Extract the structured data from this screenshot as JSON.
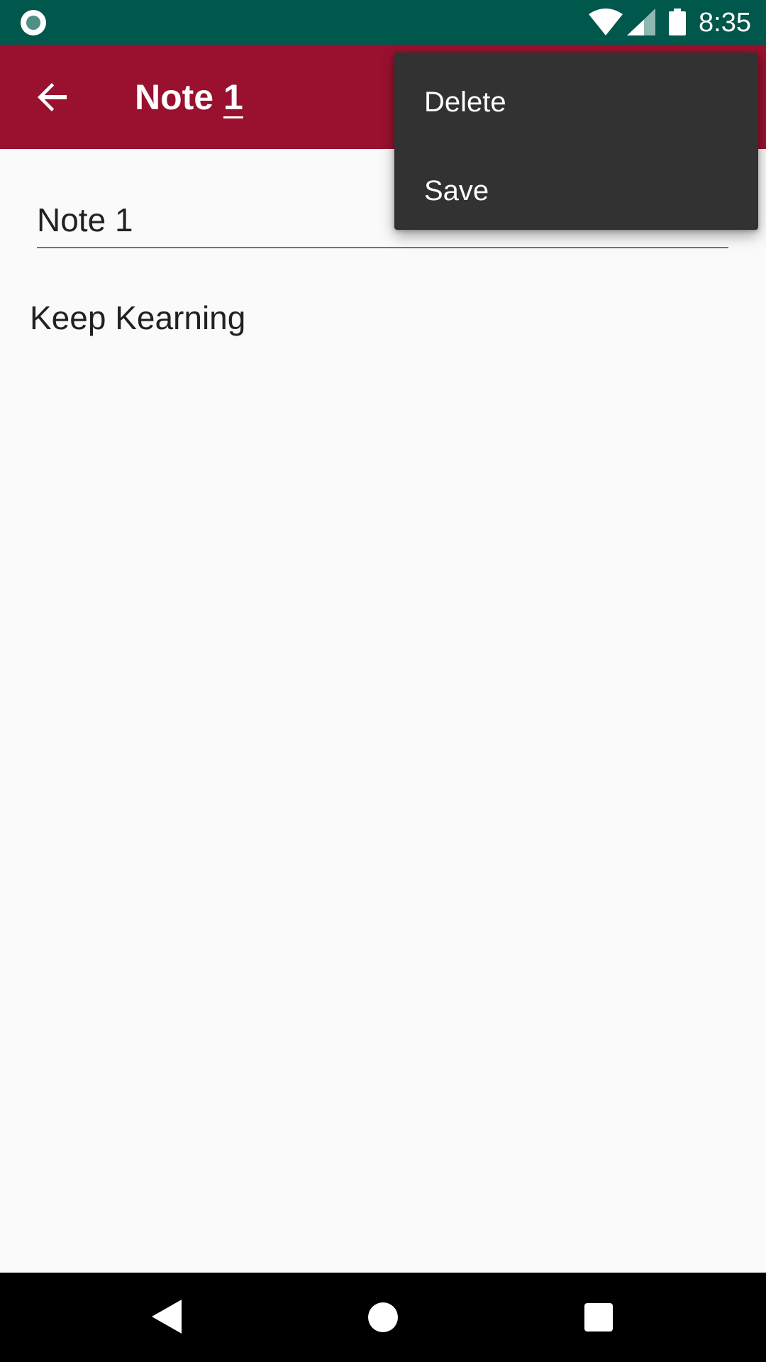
{
  "status_bar": {
    "time": "8:35",
    "icons": [
      "app-notification-icon",
      "wifi-icon",
      "signal-icon",
      "battery-icon"
    ]
  },
  "app_bar": {
    "title_word": "Note",
    "title_number": "1",
    "back_icon": "arrow-back-icon",
    "color": "#99112e"
  },
  "menu": {
    "items": [
      {
        "label": "Delete"
      },
      {
        "label": "Save"
      }
    ],
    "background": "#323232"
  },
  "note": {
    "title_value": "Note 1",
    "body_value": "Keep Kearning"
  },
  "nav_bar": {
    "icons": [
      "nav-back-icon",
      "nav-home-icon",
      "nav-recents-icon"
    ]
  },
  "colors": {
    "status_bar": "#00574b",
    "app_bar": "#99112e",
    "background": "#fafafa"
  }
}
